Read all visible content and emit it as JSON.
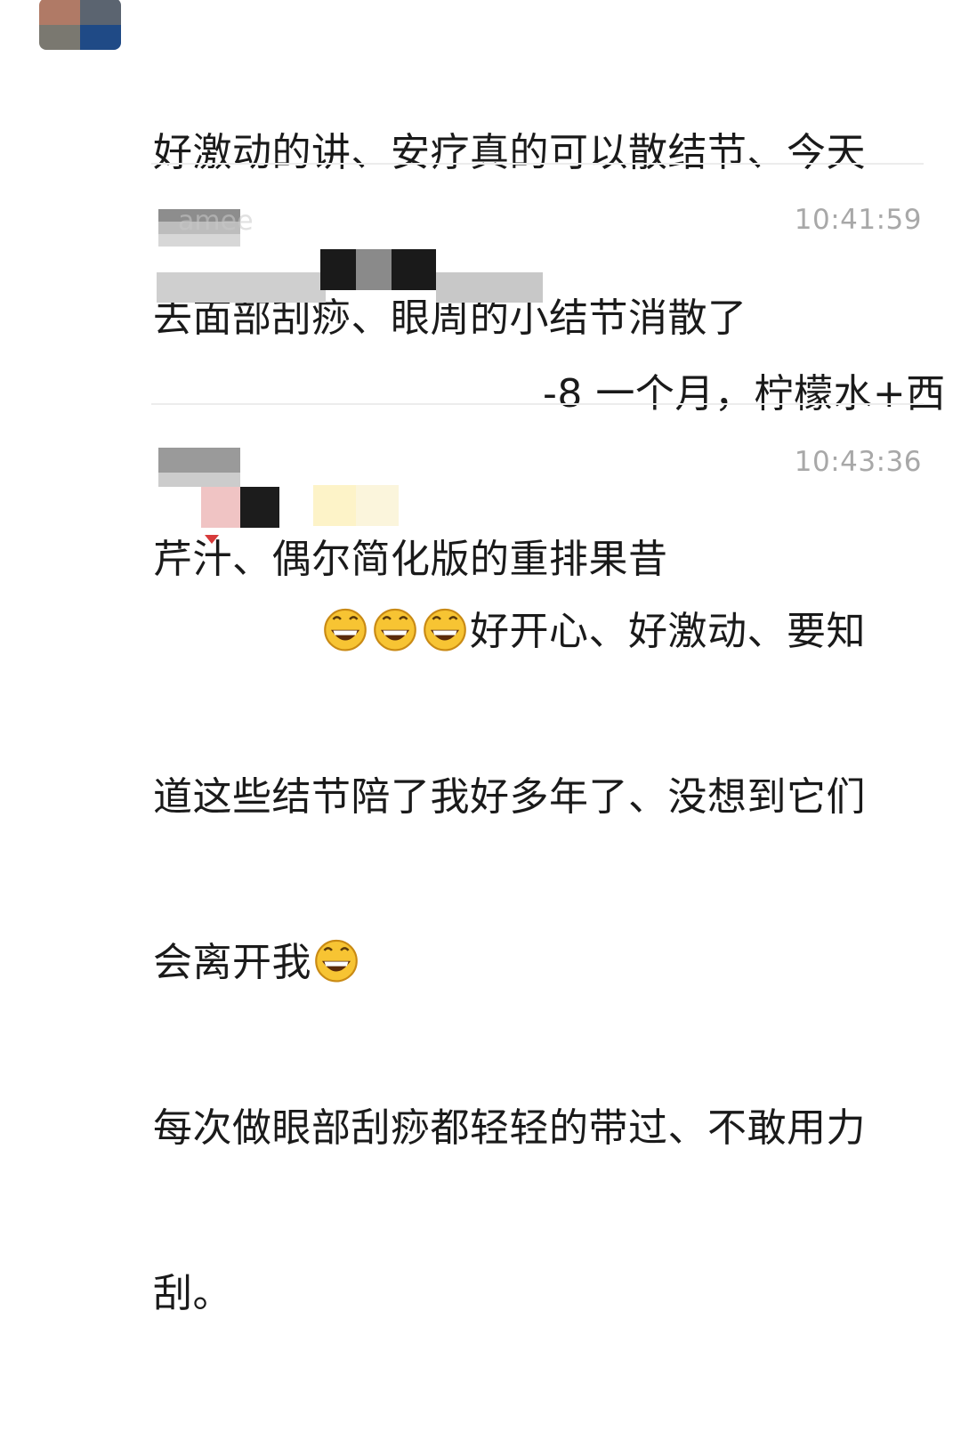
{
  "messages": [
    {
      "text_lines": [
        "好激动的讲、安疗真的可以散结节、今天",
        "去面部刮痧、眼周的小结节消散了"
      ]
    },
    {
      "time": "10:41:59",
      "nick_fragment": "amee",
      "text_line1_visible": "-8 一个月，柠檬水+西",
      "text_line2": "芹汁、偶尔简化版的重排果昔"
    },
    {
      "time": "10:43:36",
      "line1_text": "好开心、好激动、要知",
      "line2": "道这些结节陪了我好多年了、没想到它们",
      "line3_text": "会离开我",
      "line4": "每次做眼部刮痧都轻轻的带过、不敢用力",
      "line5": "刮。"
    }
  ],
  "icons": {
    "emoji": "grinning-face-emoji",
    "avatar": "pixelated-avatar"
  },
  "colors": {
    "time_text": "#a8a8a8",
    "divider": "#ececec",
    "message_text": "#1a1a1a"
  }
}
